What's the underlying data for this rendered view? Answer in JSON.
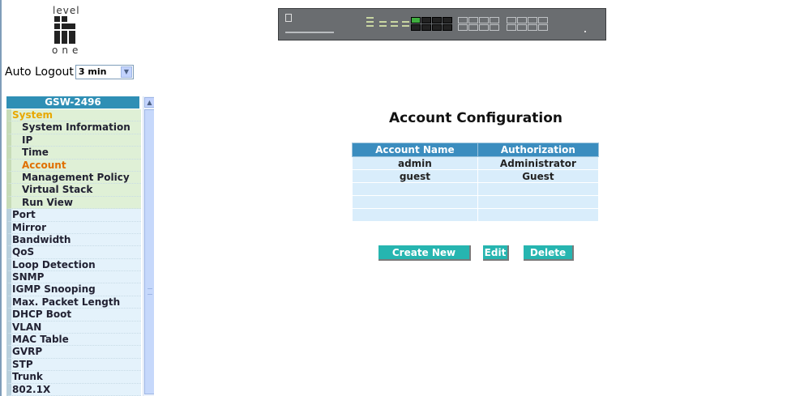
{
  "logo": {
    "top_word": "level",
    "bottom_word": "one"
  },
  "auto_logout": {
    "label": "Auto Logout",
    "selected": "3 min"
  },
  "sidebar": {
    "header": "GSW-2496",
    "items": [
      {
        "label": "System",
        "kind": "cat"
      },
      {
        "label": "System Information",
        "kind": "sub"
      },
      {
        "label": "IP",
        "kind": "sub"
      },
      {
        "label": "Time",
        "kind": "sub"
      },
      {
        "label": "Account",
        "kind": "sub",
        "active": true
      },
      {
        "label": "Management Policy",
        "kind": "sub"
      },
      {
        "label": "Virtual Stack",
        "kind": "sub"
      },
      {
        "label": "Run View",
        "kind": "sub"
      },
      {
        "label": "Port",
        "kind": "top"
      },
      {
        "label": "Mirror",
        "kind": "top"
      },
      {
        "label": "Bandwidth",
        "kind": "top"
      },
      {
        "label": "QoS",
        "kind": "top"
      },
      {
        "label": "Loop Detection",
        "kind": "top"
      },
      {
        "label": "SNMP",
        "kind": "top"
      },
      {
        "label": "IGMP Snooping",
        "kind": "top"
      },
      {
        "label": "Max. Packet Length",
        "kind": "top"
      },
      {
        "label": "DHCP Boot",
        "kind": "top"
      },
      {
        "label": "VLAN",
        "kind": "top"
      },
      {
        "label": "MAC Table",
        "kind": "top"
      },
      {
        "label": "GVRP",
        "kind": "top"
      },
      {
        "label": "STP",
        "kind": "top"
      },
      {
        "label": "Trunk",
        "kind": "top"
      },
      {
        "label": "802.1X",
        "kind": "top"
      }
    ]
  },
  "main": {
    "title": "Account Configuration",
    "table": {
      "headers": [
        "Account Name",
        "Authorization"
      ],
      "rows": [
        [
          "admin",
          "Administrator"
        ],
        [
          "guest",
          "Guest"
        ],
        [
          "",
          ""
        ],
        [
          "",
          ""
        ],
        [
          "",
          ""
        ]
      ]
    },
    "buttons": {
      "create_new": "Create New",
      "edit": "Edit",
      "delete": "Delete"
    }
  },
  "colors": {
    "sidebar_header": "#2f8fb5",
    "table_header": "#3b8dbf",
    "button": "#26b5b0",
    "active_item": "#e07000",
    "category_item": "#e8a800"
  }
}
